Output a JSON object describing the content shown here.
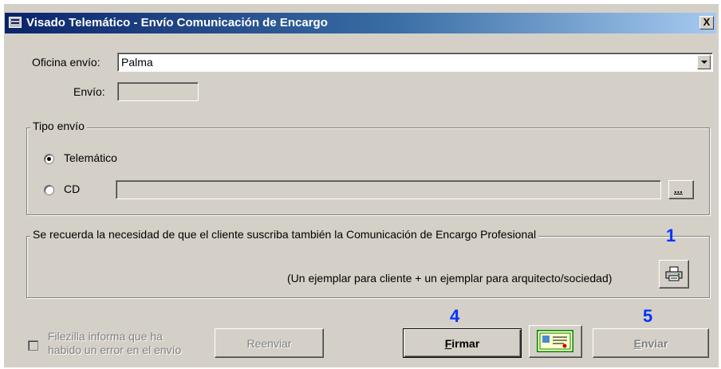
{
  "window": {
    "title": "Visado Telemático - Envío Comunicación de Encargo",
    "close_label": "X"
  },
  "form": {
    "oficina_label": "Oficina envío:",
    "oficina_value": "Palma",
    "envio_label": "Envío:",
    "envio_value": ""
  },
  "tipo_envio": {
    "legend": "Tipo envío",
    "options": [
      {
        "label": "Telemático",
        "selected": true
      },
      {
        "label": "CD",
        "selected": false
      }
    ],
    "cd_path": "",
    "browse_label": "..."
  },
  "notice": {
    "legend": "Se recuerda la necesidad de que el cliente suscriba también la Comunicación de Encargo Profesional",
    "note": "(Un ejemplar para cliente + un ejemplar para arquitecto/sociedad)",
    "print_icon": "printer-icon"
  },
  "footer": {
    "error_checkbox_line1": "Filezilla informa que ha",
    "error_checkbox_line2": "habido un error en el envío",
    "error_checked": false,
    "reenviar_label": "Reenviar",
    "firmar_first": "F",
    "firmar_rest": "irmar",
    "certificate_icon": "certificate-icon",
    "enviar_first": "E",
    "enviar_rest": "nviar"
  },
  "annotations": {
    "n1": "1",
    "n4": "4",
    "n5": "5",
    "color": "#0033ff"
  }
}
